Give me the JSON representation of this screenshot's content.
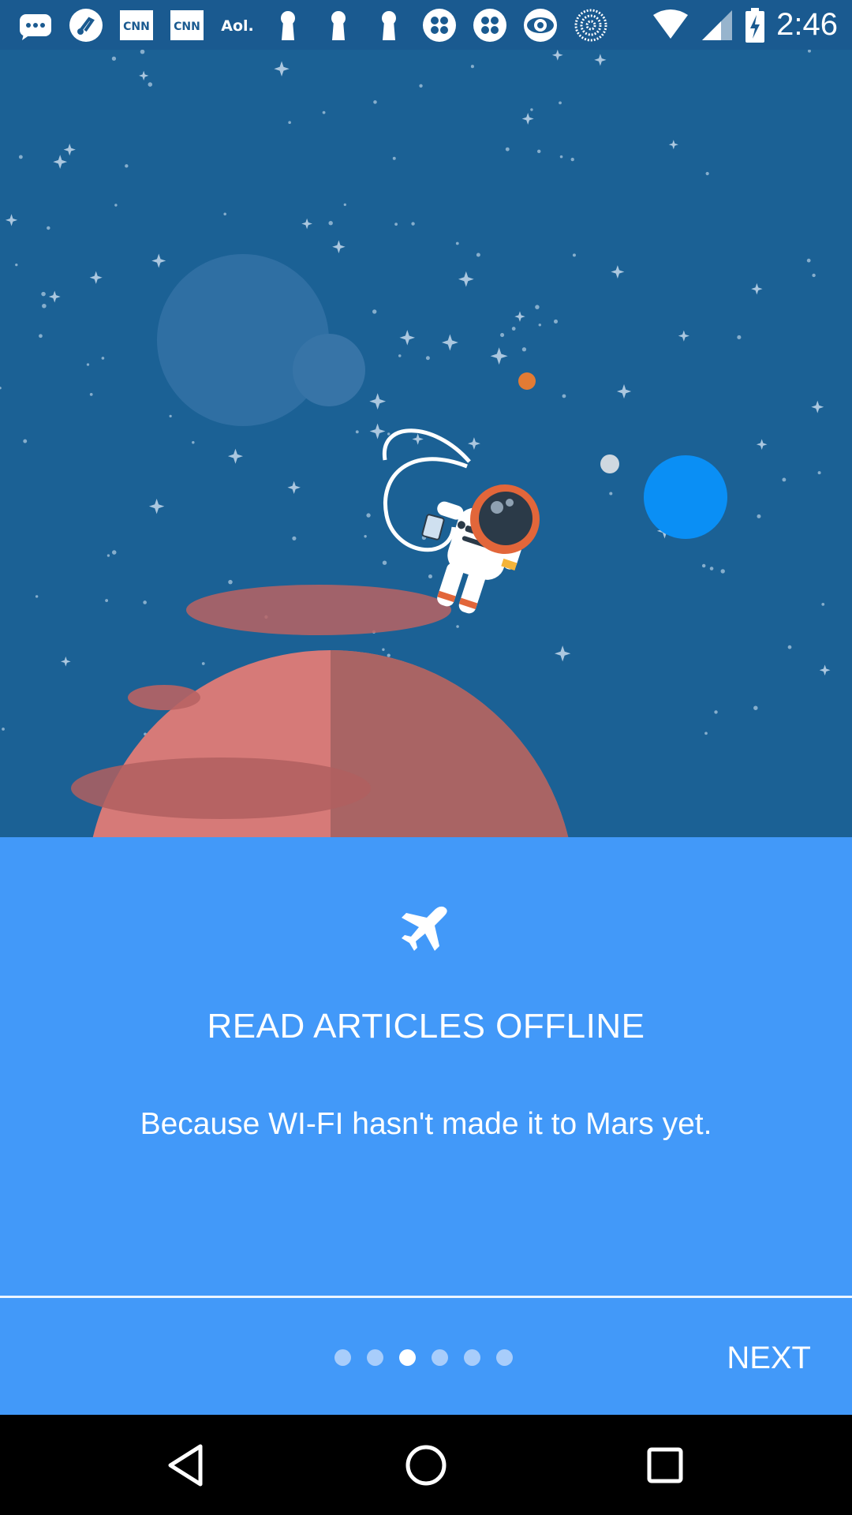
{
  "status_bar": {
    "time": "2:46",
    "notification_icons": [
      "messages-icon",
      "music-icon",
      "cnn-icon",
      "cnn-icon",
      "aol-icon",
      "keyhole-icon",
      "keyhole-icon",
      "keyhole-icon",
      "clover-icon",
      "clover-icon",
      "cbs-eye-icon",
      "dotted-sphere-icon"
    ],
    "cnn_label": "CNN",
    "aol_label": "Aol."
  },
  "onboarding": {
    "icon": "airplane-icon",
    "title": "READ ARTICLES OFFLINE",
    "subtitle": "Because WI-FI hasn't made it to Mars yet.",
    "page_count": 6,
    "current_page": 3,
    "next_label": "NEXT"
  },
  "colors": {
    "status_bar": "#1a5a90",
    "hero_background": "#1b6195",
    "panel_background": "#4299f9",
    "planet": "#d67a78",
    "blue_moon": "#0a8ff5"
  },
  "nav_bar": {
    "back": "back-triangle-icon",
    "home": "home-circle-icon",
    "recents": "recents-square-icon"
  }
}
